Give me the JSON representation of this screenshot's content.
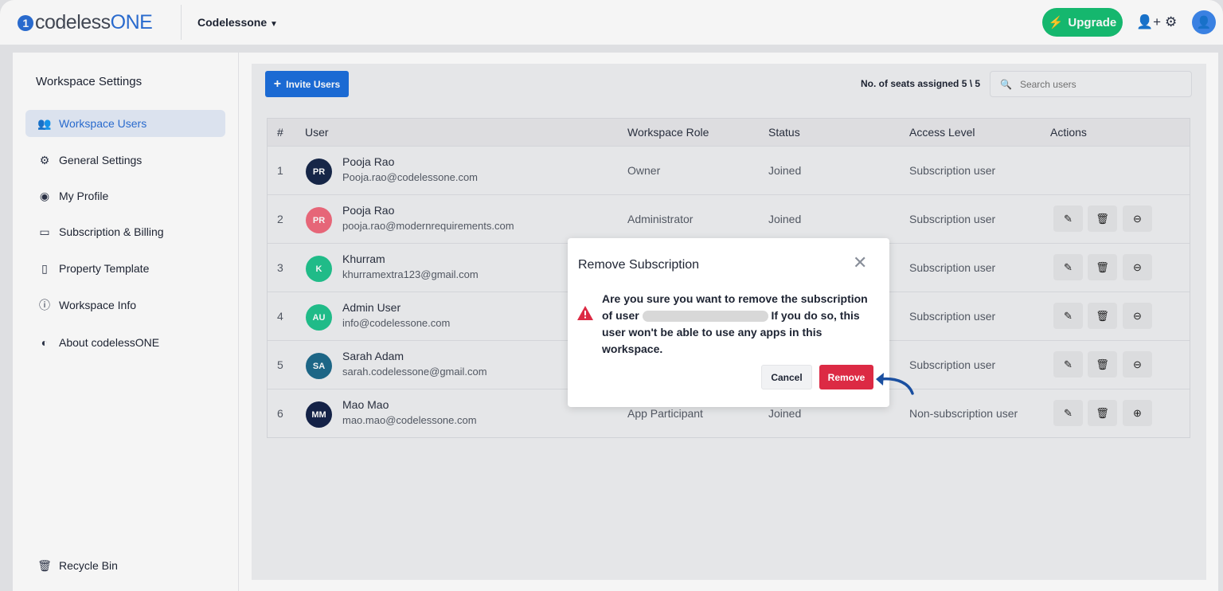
{
  "header": {
    "logo_prefix": "codeless",
    "logo_suffix": "ONE",
    "workspace": "Codelessone",
    "upgrade": "Upgrade",
    "brand_color": "#2b6fd6",
    "upgrade_color": "#16bf73"
  },
  "sidebar": {
    "title": "Workspace Settings",
    "items": [
      {
        "label": "Workspace Users",
        "icon": "users-icon",
        "active": true
      },
      {
        "label": "General Settings",
        "icon": "gear-icon"
      },
      {
        "label": "My Profile",
        "icon": "user-circle-icon"
      },
      {
        "label": "Subscription & Billing",
        "icon": "money-icon"
      },
      {
        "label": "Property Template",
        "icon": "document-icon"
      },
      {
        "label": "Workspace Info",
        "icon": "info-icon"
      },
      {
        "label": "About codelessONE",
        "icon": "logo-icon"
      }
    ],
    "recycle": "Recycle Bin"
  },
  "toolbar": {
    "invite": "Invite Users",
    "seats": "No. of seats assigned 5 \\ 5",
    "search_placeholder": "Search users"
  },
  "table": {
    "headers": [
      "#",
      "User",
      "Workspace Role",
      "Status",
      "Access Level",
      "Actions"
    ],
    "rows": [
      {
        "n": "1",
        "initials": "PR",
        "color": "#17284a",
        "name": "Pooja Rao",
        "email": "Pooja.rao@codelessone.com",
        "role": "Owner",
        "status": "Joined",
        "access": "Subscription user",
        "actions": false
      },
      {
        "n": "2",
        "initials": "PR",
        "color": "#f06b7d",
        "name": "Pooja Rao",
        "email": "pooja.rao@modernrequirements.com",
        "role": "Administrator",
        "status": "Joined",
        "access": "Subscription user",
        "actions": true,
        "toggle": "minus"
      },
      {
        "n": "3",
        "initials": "K",
        "color": "#22c38e",
        "name": "Khurram",
        "email": "khurramextra123@gmail.com",
        "role": "",
        "status": "",
        "access": "Subscription user",
        "actions": true,
        "toggle": "minus"
      },
      {
        "n": "4",
        "initials": "AU",
        "color": "#22c38e",
        "name": "Admin User",
        "email": "info@codelessone.com",
        "role": "",
        "status": "",
        "access": "Subscription user",
        "actions": true,
        "toggle": "minus"
      },
      {
        "n": "5",
        "initials": "SA",
        "color": "#1f6b8c",
        "name": "Sarah Adam",
        "email": "sarah.codelessone@gmail.com",
        "role": "",
        "status": "",
        "access": "Subscription user",
        "actions": true,
        "toggle": "minus"
      },
      {
        "n": "6",
        "initials": "MM",
        "color": "#15244a",
        "name": "Mao Mao",
        "email": "mao.mao@codelessone.com",
        "role": "App Participant",
        "status": "Joined",
        "access": "Non-subscription user",
        "actions": true,
        "toggle": "plus"
      }
    ]
  },
  "modal": {
    "title": "Remove Subscription",
    "text_before": "Are you sure you want to remove the subscription of user",
    "text_after": "If you do so, this user won't be able to use any apps in this workspace.",
    "cancel": "Cancel",
    "remove": "Remove",
    "remove_color": "#dc2a44"
  }
}
